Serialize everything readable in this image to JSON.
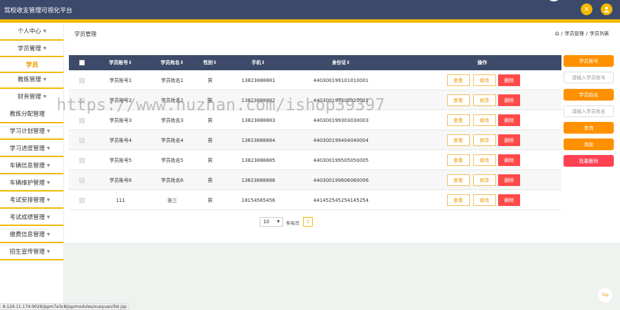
{
  "header": {
    "title": "驾校收支管理可视化平台",
    "close_icon": "×",
    "user_icon": "person-icon"
  },
  "sidebar": {
    "items": [
      {
        "label": "个人中心"
      },
      {
        "label": "学员管理"
      },
      {
        "label": "学员",
        "active": true
      },
      {
        "label": "教练管理"
      },
      {
        "label": "财务管理"
      },
      {
        "label": "教练分配管理"
      },
      {
        "label": "学习计划管理"
      },
      {
        "label": "学习进度管理"
      },
      {
        "label": "车辆信息管理"
      },
      {
        "label": "车辆维护管理"
      },
      {
        "label": "考试安排管理"
      },
      {
        "label": "考试成绩管理"
      },
      {
        "label": "缴费信息管理"
      },
      {
        "label": "招生宣传管理"
      }
    ]
  },
  "page": {
    "title": "学员管理",
    "breadcrumb": [
      "学员管理",
      "学员列表"
    ]
  },
  "table": {
    "headers": [
      "学员账号",
      "学员姓名",
      "性别",
      "手机",
      "身份证",
      "操作"
    ],
    "rows": [
      [
        "学员账号1",
        "学员姓名1",
        "男",
        "13823888881",
        "440300199101010001"
      ],
      [
        "学员账号2",
        "学员姓名2",
        "男",
        "13823888882",
        "440300199202020002"
      ],
      [
        "学员账号3",
        "学员姓名3",
        "男",
        "13823888883",
        "440300199303030003"
      ],
      [
        "学员账号4",
        "学员姓名4",
        "男",
        "13823888884",
        "440300199404040004"
      ],
      [
        "学员账号5",
        "学员姓名5",
        "男",
        "13823888885",
        "440300199505050005"
      ],
      [
        "学员账号6",
        "学员姓名6",
        "男",
        "13823888886",
        "440300199606060006"
      ],
      [
        "111",
        "张三",
        "男",
        "18154565456",
        "441452545254145254"
      ]
    ],
    "actions": {
      "view": "查看",
      "edit": "修改",
      "delete": "删除"
    }
  },
  "filters": {
    "account_label": "学员账号",
    "account_placeholder": "请输入学员账号",
    "name_label": "学员姓名",
    "name_placeholder": "请输入学员姓名",
    "search": "查询",
    "add": "添加",
    "batch_delete": "批量删除"
  },
  "pagination": {
    "page_size": "10",
    "per_page_label": "条每页",
    "current_page": "1"
  },
  "watermark": "https://www.huzhan.com/ishop39397",
  "top_button": "Top",
  "status_url": "8.129.11.174:9029/jspm7e3c8/jsp/modules/xueyuan/list.jsp",
  "colors": {
    "accent": "#f5b800",
    "header": "#3b4a6b",
    "danger": "#ff4a4a",
    "orange": "#ff9100"
  }
}
